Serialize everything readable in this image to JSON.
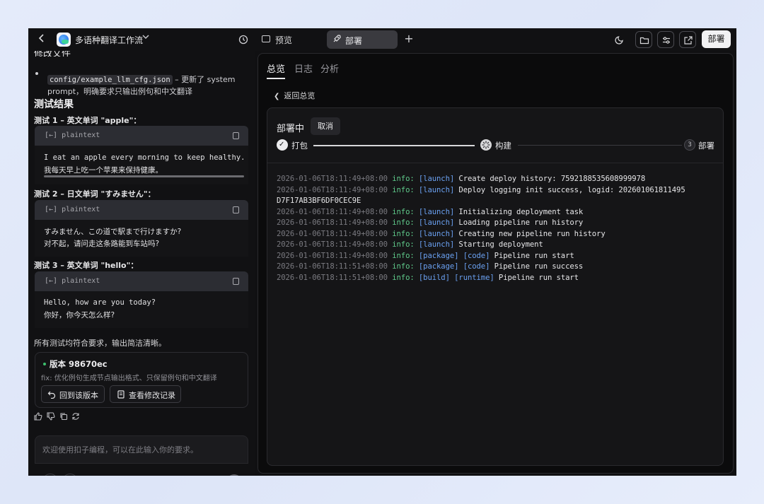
{
  "topbar": {
    "app_title": "多语种翻译工作流",
    "tab_preview": "预览",
    "tab_deploy": "部署",
    "tab_add": "+",
    "deploy_button": "部署",
    "icons": [
      "back-icon",
      "history-icon",
      "moon-icon",
      "folder-icon",
      "settings-sliders-icon",
      "external-link-icon"
    ]
  },
  "chat": {
    "cut_heading": "修改文件",
    "file_code": "config/example_llm_cfg.json",
    "file_desc_1": " – 更新了 system",
    "file_desc_2": "prompt，明确要求只输出例句和中文翻译",
    "results_heading": "测试结果",
    "tests": [
      {
        "title": "测试 1 – 英文单词 \"apple\"：",
        "lang": "plaintext",
        "line1": "I eat an apple every morning to keep healthy.",
        "line2": "我每天早上吃一个苹果来保持健康。"
      },
      {
        "title": "测试 2 – 日文单词 \"すみません\"：",
        "lang": "plaintext",
        "line1": "すみません、この道で駅まで行けますか?",
        "line2": "对不起，请问走这条路能到车站吗?"
      },
      {
        "title": "测试 3 – 英文单词 \"hello\"：",
        "lang": "plaintext",
        "line1": "Hello, how are you today?",
        "line2": "你好，你今天怎么样?"
      }
    ],
    "summary": "所有测试均符合要求，输出简洁清晰。",
    "version": {
      "name": "版本 98670ec",
      "desc": "fix: 优化例句生成节点输出格式、只保留例句和中文翻译",
      "btn_revert": "回到该版本",
      "btn_changes": "查看修改记录"
    },
    "input_placeholder": "欢迎使用扣子编程，可以在此输入你的要求。"
  },
  "deploy_panel": {
    "tabs": [
      "总览",
      "日志",
      "分析"
    ],
    "back_label": "返回总览",
    "status_title": "部署中",
    "cancel_label": "取消",
    "steps": [
      {
        "label": "打包",
        "state": "done"
      },
      {
        "label": "构建",
        "state": "in-progress"
      },
      {
        "label": "部署",
        "state": "pending",
        "number": "3"
      }
    ],
    "logs": [
      {
        "ts": "2026-01-06T18:11:49+08:00",
        "level": "info:",
        "tags": [
          "[launch]"
        ],
        "msg": "Create deploy history: 7592188535608999978"
      },
      {
        "ts": "2026-01-06T18:11:49+08:00",
        "level": "info:",
        "tags": [
          "[launch]"
        ],
        "msg": "Deploy logging init success, logid: 202601061811495",
        "cont": "D7F17AB3BF6DF0CEC9E"
      },
      {
        "ts": "2026-01-06T18:11:49+08:00",
        "level": "info:",
        "tags": [
          "[launch]"
        ],
        "msg": "Initializing deployment task"
      },
      {
        "ts": "2026-01-06T18:11:49+08:00",
        "level": "info:",
        "tags": [
          "[launch]"
        ],
        "msg": "Loading pipeline run history"
      },
      {
        "ts": "2026-01-06T18:11:49+08:00",
        "level": "info:",
        "tags": [
          "[launch]"
        ],
        "msg": "Creating new pipeline run history"
      },
      {
        "ts": "2026-01-06T18:11:49+08:00",
        "level": "info:",
        "tags": [
          "[launch]"
        ],
        "msg": "Starting deployment"
      },
      {
        "ts": "2026-01-06T18:11:49+08:00",
        "level": "info:",
        "tags": [
          "[package]",
          "[code]"
        ],
        "msg": "Pipeline run start"
      },
      {
        "ts": "2026-01-06T18:11:51+08:00",
        "level": "info:",
        "tags": [
          "[package]",
          "[code]"
        ],
        "msg": "Pipeline run success"
      },
      {
        "ts": "2026-01-06T18:11:51+08:00",
        "level": "info:",
        "tags": [
          "[build]",
          "[runtime]"
        ],
        "msg": "Pipeline run start"
      }
    ]
  },
  "colors": {
    "window_bg": "#101012",
    "log_timestamp": "#7a7a80",
    "log_level": "#5fc98a",
    "log_tag": "#6aa0f0",
    "status_dot": "#3dbf6e"
  }
}
